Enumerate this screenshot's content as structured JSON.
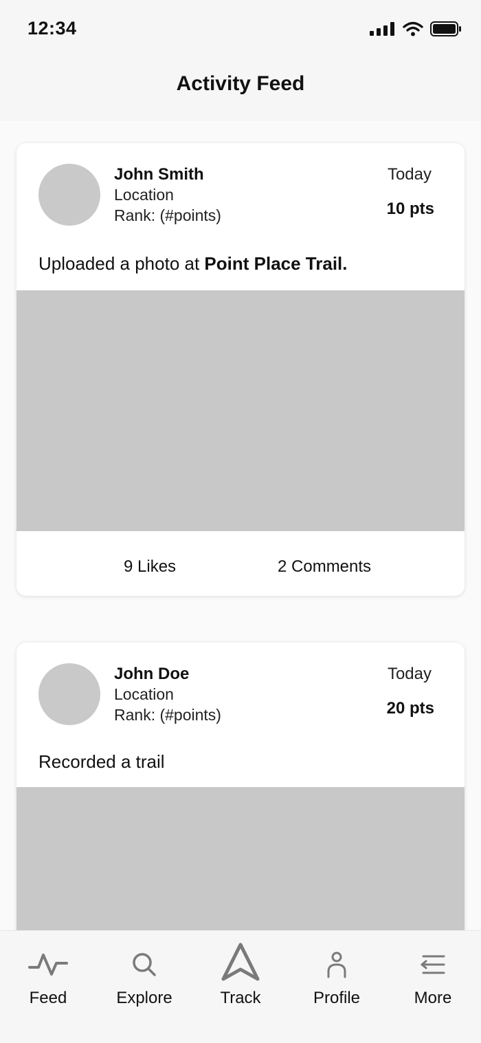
{
  "status_bar": {
    "time": "12:34",
    "icons": [
      "cellular-signal-icon",
      "wifi-icon",
      "battery-icon"
    ]
  },
  "header": {
    "title": "Activity Feed"
  },
  "posts": [
    {
      "user_name": "John Smith",
      "location": "Location",
      "rank": "Rank: (#points)",
      "date": "Today",
      "points": "10 pts",
      "action_text": "Uploaded a photo at ",
      "action_place": "Point Place Trail.",
      "likes": "9 Likes",
      "comments": "2 Comments"
    },
    {
      "user_name": "John Doe",
      "location": "Location",
      "rank": "Rank: (#points)",
      "date": "Today",
      "points": "20 pts",
      "action_text": "Recorded a trail"
    }
  ],
  "tab_bar": {
    "tabs": [
      {
        "label": "Feed",
        "icon": "activity-icon"
      },
      {
        "label": "Explore",
        "icon": "search-icon"
      },
      {
        "label": "Track",
        "icon": "navigation-arrow-icon"
      },
      {
        "label": "Profile",
        "icon": "person-icon"
      },
      {
        "label": "More",
        "icon": "menu-icon"
      }
    ]
  },
  "colors": {
    "background": "#f6f6f6",
    "card": "#ffffff",
    "placeholder": "#c8c8c8",
    "icon": "#7a7a7a",
    "text": "#111111"
  }
}
